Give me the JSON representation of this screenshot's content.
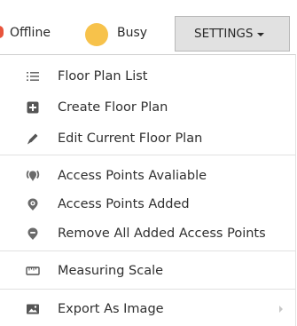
{
  "status_bar": {
    "offline_label": "Offline",
    "busy_label": "Busy",
    "offline_color": "#e8543c",
    "busy_color": "#f7c24b"
  },
  "settings_button": {
    "label": "SETTINGS"
  },
  "menu": {
    "groups": [
      {
        "items": [
          {
            "label": "Floor Plan List",
            "icon": "list-icon"
          },
          {
            "label": "Create Floor Plan",
            "icon": "plus-square-icon"
          },
          {
            "label": "Edit Current Floor Plan",
            "icon": "pencil-icon"
          }
        ]
      },
      {
        "items": [
          {
            "label": "Access Points Avaliable",
            "icon": "access-point-icon"
          },
          {
            "label": "Access Points Added",
            "icon": "access-point-added-icon"
          },
          {
            "label": "Remove All Added Access Points",
            "icon": "access-point-remove-icon"
          }
        ]
      },
      {
        "items": [
          {
            "label": "Measuring Scale",
            "icon": "ruler-icon"
          }
        ]
      },
      {
        "items": [
          {
            "label": "Export As Image",
            "icon": "image-icon",
            "has_submenu": true
          }
        ]
      }
    ]
  }
}
